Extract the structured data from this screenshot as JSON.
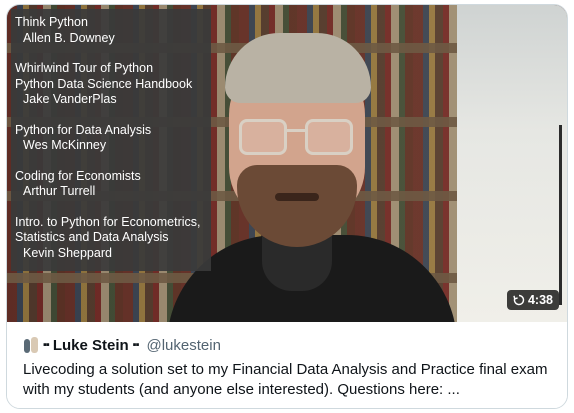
{
  "video": {
    "books": [
      {
        "title": "Think Python",
        "authors": [
          "Allen B. Downey"
        ]
      },
      {
        "title": "Whirlwind Tour of Python",
        "title2": "Python Data Science Handbook",
        "authors": [
          "Jake VanderPlas"
        ]
      },
      {
        "title": "Python for Data Analysis",
        "authors": [
          "Wes McKinney"
        ]
      },
      {
        "title": "Coding for Economists",
        "authors": [
          "Arthur Turrell"
        ]
      },
      {
        "title": "Intro. to Python for Econometrics,",
        "title2": "Statistics and Data Analysis",
        "authors": [
          "Kevin Sheppard"
        ]
      }
    ],
    "duration": "4:38",
    "duration_icon": "replay-icon"
  },
  "tweet": {
    "flag_text": "▪▪",
    "display_name": "Luke Stein",
    "handle": "@lukestein",
    "text": "Livecoding a solution set to my Financial Data Analysis and Practice final exam with my students (and anyone else interested). Questions here:  ..."
  }
}
